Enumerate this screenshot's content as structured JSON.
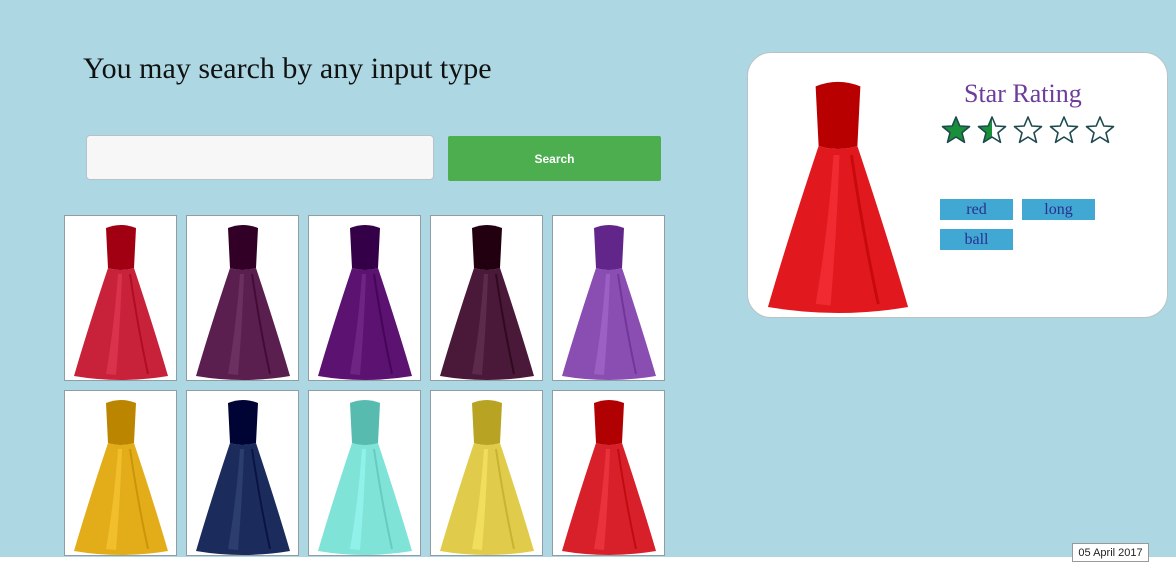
{
  "search": {
    "heading": "You may search by any input type",
    "input_value": "",
    "button_label": "Search"
  },
  "dresses": [
    {
      "name": "dress-red-short",
      "color": "#c8213a"
    },
    {
      "name": "dress-plum-ruffled",
      "color": "#5a1f4e"
    },
    {
      "name": "dress-purple-strapless",
      "color": "#5c1270"
    },
    {
      "name": "dress-plum-satin",
      "color": "#4a1838"
    },
    {
      "name": "dress-lavender-lace",
      "color": "#8a4eb2"
    },
    {
      "name": "dress-yellow-pleated",
      "color": "#e3ad1a"
    },
    {
      "name": "dress-navy-lace",
      "color": "#1b2c5c"
    },
    {
      "name": "dress-aqua-tulle",
      "color": "#7fe3d8"
    },
    {
      "name": "dress-gold-satin",
      "color": "#e0cc4a"
    },
    {
      "name": "dress-red-polka",
      "color": "#d8202a"
    }
  ],
  "detail": {
    "rating_title": "Star Rating",
    "rating": 1.5,
    "rating_max": 5,
    "star_fill": "#1a8f3a",
    "tags": [
      "red",
      "long",
      "ball"
    ],
    "dress_color": "#e1191e"
  },
  "footer": {
    "date": "05 April 2017"
  }
}
